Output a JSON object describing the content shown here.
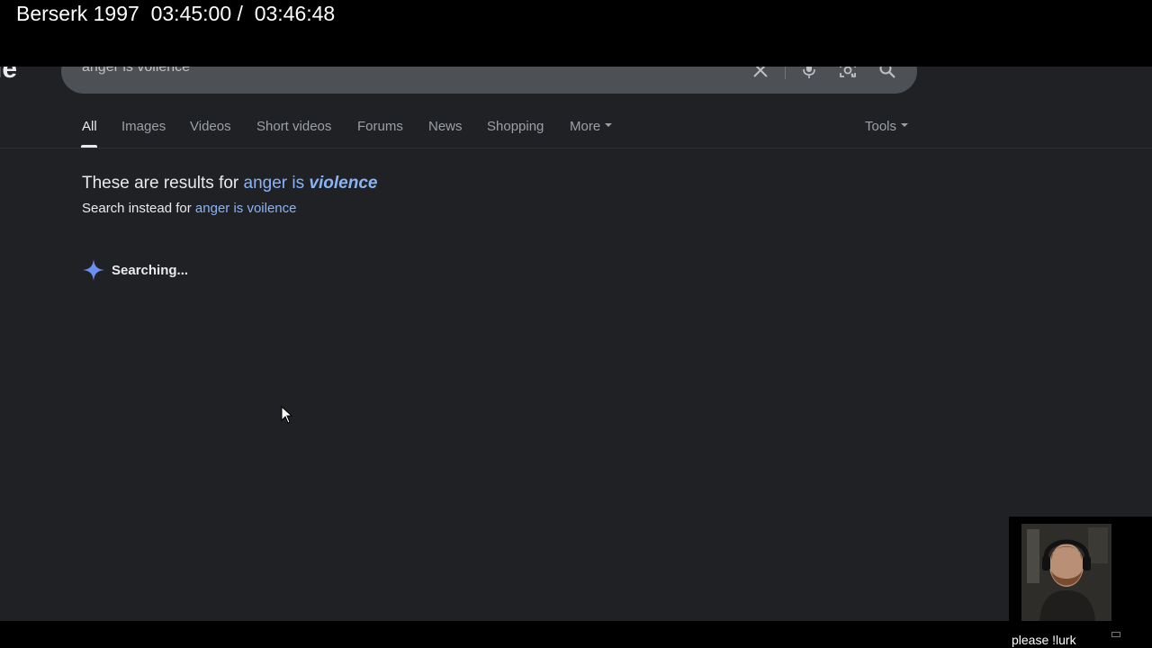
{
  "overlay": {
    "title": "Berserk 1997",
    "time_current": "03:45:00 /",
    "time_total": "03:46:48"
  },
  "search": {
    "query": "anger is voilence",
    "logo_fragment": "le"
  },
  "tabs": [
    {
      "label": "All",
      "active": true
    },
    {
      "label": "Images"
    },
    {
      "label": "Videos"
    },
    {
      "label": "Short videos"
    },
    {
      "label": "Forums"
    },
    {
      "label": "News"
    },
    {
      "label": "Shopping"
    },
    {
      "label": "More"
    }
  ],
  "tools_label": "Tools",
  "spelling": {
    "prefix": "These are results for",
    "corrected_plain": "anger is",
    "corrected_bold": "violence",
    "instead_prefix": "Search instead for",
    "original_query": "anger is voilence"
  },
  "ai_status": {
    "text": "Searching..."
  },
  "webcam": {
    "caption": "please !lurk"
  },
  "colors": {
    "page_bg": "#202124",
    "link": "#8ab4f8",
    "text": "#e8eaed",
    "muted": "#9aa0a6",
    "gemini_spark": "#6a8ff0"
  }
}
